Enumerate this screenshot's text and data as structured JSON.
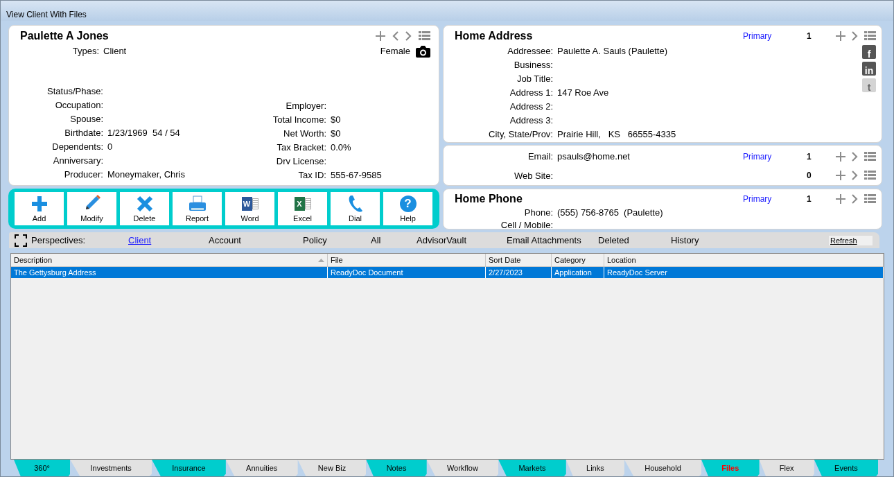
{
  "window": {
    "title": "View Client With Files"
  },
  "client": {
    "name": "Paulette A Jones",
    "gender": "Female",
    "types": {
      "label": "Types:",
      "value": "Client"
    },
    "left_fields": [
      {
        "label": "Status/Phase:"
      },
      {
        "label": "Occupation:"
      },
      {
        "label": "Spouse:"
      },
      {
        "label": "Birthdate:",
        "value": "1/23/1969  54 / 54"
      },
      {
        "label": "Dependents:",
        "value": "0"
      },
      {
        "label": "Anniversary:"
      },
      {
        "label": "Producer:",
        "value": "Moneymaker, Chris"
      }
    ],
    "right_fields": [
      {
        "label": "Employer:"
      },
      {
        "label": "Total Income:",
        "value": "$0"
      },
      {
        "label": "Net Worth:",
        "value": "$0"
      },
      {
        "label": "Tax Bracket:",
        "value": "0.0%"
      },
      {
        "label": "Drv License:"
      },
      {
        "label": "Tax ID:",
        "value": "555-67-9585"
      }
    ]
  },
  "address": {
    "title": "Home Address",
    "primary": "Primary",
    "count": "1",
    "fields": [
      {
        "label": "Addressee:",
        "value": "Paulette A. Sauls (Paulette)"
      },
      {
        "label": "Business:"
      },
      {
        "label": "Job Title:"
      },
      {
        "label": "Address 1:",
        "value": "147 Roe Ave"
      },
      {
        "label": "Address 2:"
      },
      {
        "label": "Address 3:"
      },
      {
        "label": "City, State/Prov:",
        "value": "Prairie Hill,   KS   66555-4335"
      }
    ],
    "social": [
      {
        "glyph": "f",
        "disabled": false
      },
      {
        "glyph": "in",
        "disabled": false
      },
      {
        "glyph": "t",
        "disabled": true
      }
    ]
  },
  "contact": {
    "rows": [
      {
        "label": "Email:",
        "value": "psauls@home.net",
        "primary": "Primary",
        "count": "1"
      },
      {
        "label": "Web Site:",
        "count": "0"
      }
    ]
  },
  "phone": {
    "title": "Home Phone",
    "primary": "Primary",
    "count": "1",
    "fields": [
      {
        "label": "Phone:",
        "value": "(555) 756-8765  (Paulette)"
      },
      {
        "label": "Cell / Mobile:"
      }
    ]
  },
  "toolbar": [
    {
      "kind": "add",
      "label": "Add"
    },
    {
      "kind": "modify",
      "label": "Modify"
    },
    {
      "kind": "delete",
      "label": "Delete"
    },
    {
      "kind": "report",
      "label": "Report"
    },
    {
      "kind": "word",
      "label": "Word",
      "glyph": "W"
    },
    {
      "kind": "excel",
      "label": "Excel",
      "glyph": "X"
    },
    {
      "kind": "dial",
      "label": "Dial"
    },
    {
      "kind": "help",
      "label": "Help",
      "glyph": "?"
    }
  ],
  "perspectives": {
    "label": "Perspectives:",
    "items": [
      {
        "label": "Client",
        "selected": true
      },
      {
        "label": "Account",
        "selected": false
      },
      {
        "label": "Policy",
        "selected": false
      },
      {
        "label": "All",
        "selected": false
      },
      {
        "label": "AdvisorVault",
        "selected": false
      },
      {
        "label": "Email Attachments",
        "selected": false
      },
      {
        "label": "Deleted",
        "selected": false
      },
      {
        "label": "History",
        "selected": false
      }
    ],
    "refresh": "Refresh"
  },
  "table": {
    "columns": [
      "Description",
      "File",
      "Sort Date",
      "Category",
      "Location"
    ],
    "rows": [
      {
        "cells": [
          "The Gettysburg Address",
          "ReadyDoc Document",
          "2/27/2023",
          "Application",
          "ReadyDoc Server"
        ],
        "selected": true
      }
    ]
  },
  "tabs": [
    {
      "label": "360°",
      "highlighted": true,
      "selected": false
    },
    {
      "label": "Investments",
      "highlighted": false,
      "selected": false
    },
    {
      "label": "Insurance",
      "highlighted": true,
      "selected": false
    },
    {
      "label": "Annuities",
      "highlighted": false,
      "selected": false
    },
    {
      "label": "New Biz",
      "highlighted": false,
      "selected": false
    },
    {
      "label": "Notes",
      "highlighted": true,
      "selected": false
    },
    {
      "label": "Workflow",
      "highlighted": false,
      "selected": false
    },
    {
      "label": "Markets",
      "highlighted": true,
      "selected": false
    },
    {
      "label": "Links",
      "highlighted": false,
      "selected": false
    },
    {
      "label": "Household",
      "highlighted": false,
      "selected": false
    },
    {
      "label": "Files",
      "highlighted": true,
      "selected": true
    },
    {
      "label": "Flex",
      "highlighted": false,
      "selected": false
    },
    {
      "label": "Events",
      "highlighted": true,
      "selected": false
    }
  ]
}
